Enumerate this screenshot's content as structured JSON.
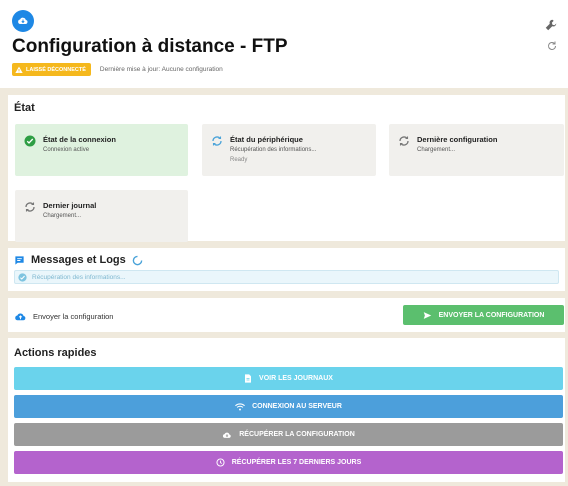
{
  "header": {
    "title": "Configuration à distance - FTP",
    "warning_badge": "LAISSÉ DÉCONNECTÉ",
    "last_update": "Dernière mise à jour: Aucune configuration"
  },
  "etat": {
    "title": "État",
    "cards": [
      {
        "title": "État de la connexion",
        "subtitle": "Connexion active",
        "status": "success",
        "icon": "check-circle-icon",
        "color": "#2e9e44"
      },
      {
        "title": "État du périphérique",
        "subtitle": "Récupération des informations...",
        "extra": "Ready",
        "status": "loading",
        "icon": "sync-icon",
        "color": "#4aa3d9"
      },
      {
        "title": "Dernière configuration",
        "subtitle": "Chargement...",
        "status": "loading",
        "icon": "sync-icon",
        "color": "#777777"
      },
      {
        "title": "Dernier journal",
        "subtitle": "Chargement...",
        "status": "loading",
        "icon": "sync-icon",
        "color": "#777777"
      }
    ]
  },
  "messages": {
    "title": "Messages et Logs",
    "info": "Récupération des informations..."
  },
  "send": {
    "label": "Envoyer la configuration",
    "button": "ENVOYER LA CONFIGURATION"
  },
  "actions": {
    "title": "Actions rapides",
    "buttons": [
      {
        "label": "VOIR LES JOURNAUX",
        "icon": "file-icon",
        "color": "#6ad3ec"
      },
      {
        "label": "CONNEXION AU SERVEUR",
        "icon": "wifi-icon",
        "color": "#4c9fdb"
      },
      {
        "label": "RÉCUPÉRER LA CONFIGURATION",
        "icon": "cloud-download-icon",
        "color": "#9b9b9b"
      },
      {
        "label": "RÉCUPÉRER LES 7 DERNIERS JOURS",
        "icon": "clock-icon",
        "color": "#b463cd"
      }
    ]
  },
  "colors": {
    "brand": "#1e88e5",
    "background": "#efe9dc",
    "warning": "#f5b81d",
    "success": "#5bbf6e"
  }
}
